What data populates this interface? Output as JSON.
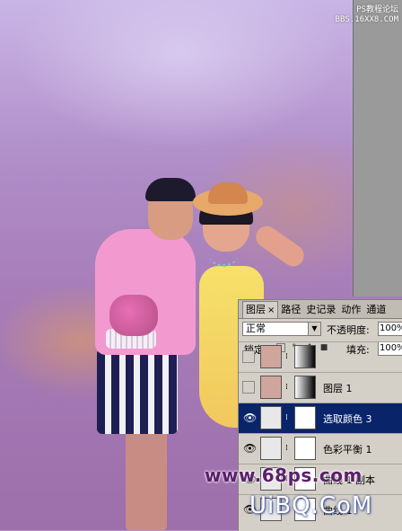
{
  "site_watermark": {
    "line1": "PS教程论坛",
    "line2": "BBS.16XX8.COM"
  },
  "layers_panel": {
    "tabs": [
      {
        "label": "图层",
        "active": true,
        "close": "×"
      },
      {
        "label": "路径",
        "active": false
      },
      {
        "label": "史记录",
        "active": false
      },
      {
        "label": "动作",
        "active": false
      },
      {
        "label": "通道",
        "active": false
      }
    ],
    "blend_mode": "正常",
    "opacity_label": "不透明度:",
    "opacity_value": "100%",
    "lock_label": "锁定:",
    "lock_icons": [
      "transparency-lock-icon",
      "brush-lock-icon",
      "move-lock-icon",
      "padlock-icon"
    ],
    "fill_label": "填充:",
    "fill_value": "100%",
    "layers": [
      {
        "name": "",
        "visible": false,
        "thumb_color": "#d0a69c",
        "mask": "gradient"
      },
      {
        "name": "图层 1",
        "visible": false,
        "thumb_color": "#d0a69c",
        "mask": "gradient"
      },
      {
        "name": "选取颜色 3",
        "visible": true,
        "selected": true,
        "thumb_color": "#e8e8e8",
        "mask": "white"
      },
      {
        "name": "色彩平衡 1",
        "visible": true,
        "thumb_color": "#e8e8e8",
        "mask": "white"
      },
      {
        "name": "曲线 1 副本",
        "visible": true,
        "thumb_color": "#e8e8e8",
        "mask": "white"
      },
      {
        "name": "曲线 1",
        "visible": true,
        "thumb_color": "#e8e8e8",
        "mask": "white"
      }
    ],
    "eye_icon": "👁"
  },
  "watermarks": {
    "ps68": "www.68ps.com",
    "uibq": "UiBQ.CoM"
  }
}
